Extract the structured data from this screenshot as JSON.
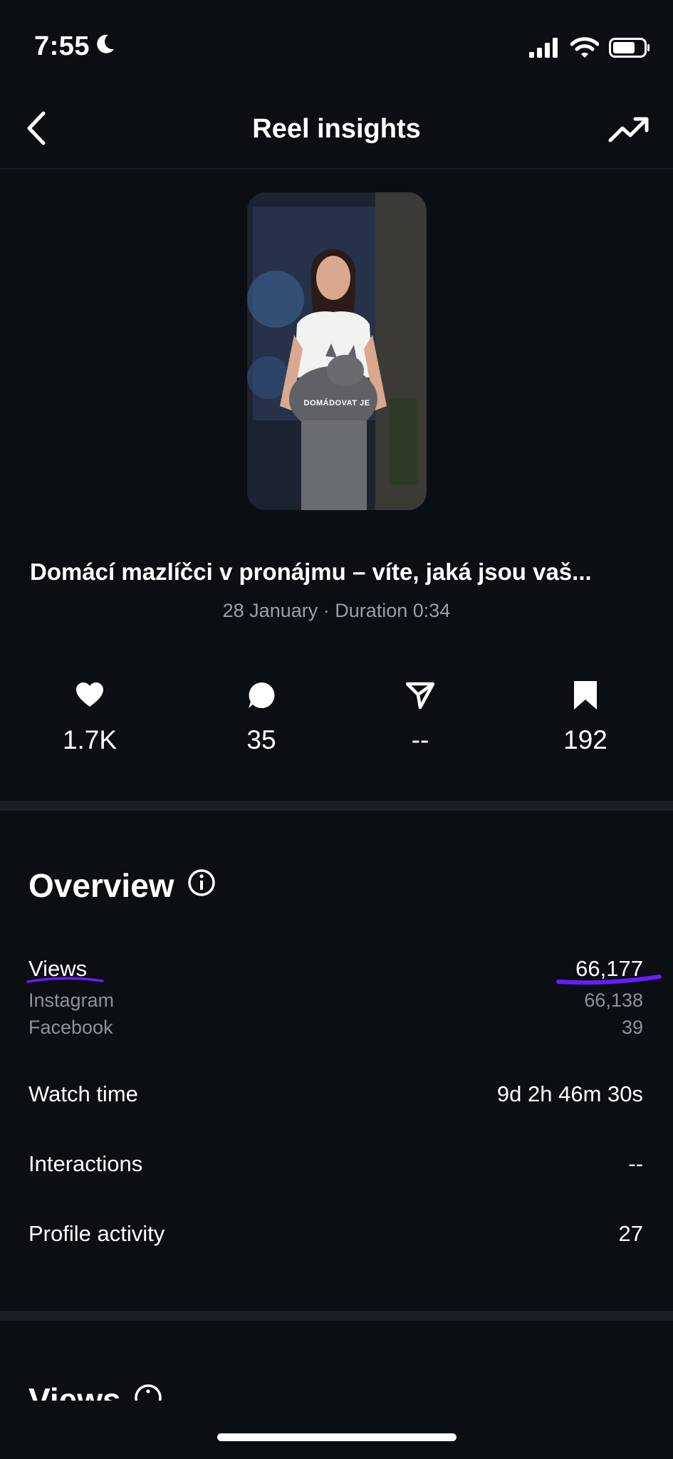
{
  "status_bar": {
    "time": "7:55"
  },
  "nav": {
    "title": "Reel insights"
  },
  "reel": {
    "thumbnail_caption": "DOMÁDOVAT JE",
    "title": "Domácí mazlíčci v pronájmu – víte, jaká jsou vaš...",
    "meta": "28 January · Duration 0:34"
  },
  "stats": [
    {
      "icon": "heart-icon",
      "value": "1.7K"
    },
    {
      "icon": "comment-icon",
      "value": "35"
    },
    {
      "icon": "share-icon",
      "value": "--"
    },
    {
      "icon": "bookmark-icon",
      "value": "192"
    }
  ],
  "overview": {
    "title": "Overview",
    "views": {
      "label": "Views",
      "value": "66,177"
    },
    "instagram": {
      "label": "Instagram",
      "value": "66,138"
    },
    "facebook": {
      "label": "Facebook",
      "value": "39"
    },
    "watch_time": {
      "label": "Watch time",
      "value": "9d 2h 46m 30s"
    },
    "interactions": {
      "label": "Interactions",
      "value": "--"
    },
    "profile_activity": {
      "label": "Profile activity",
      "value": "27"
    }
  },
  "views_section": {
    "title": "Views"
  },
  "colors": {
    "background": "#0b0e13",
    "annotation": "#6a1bff",
    "secondary_text": "#8d939b"
  }
}
